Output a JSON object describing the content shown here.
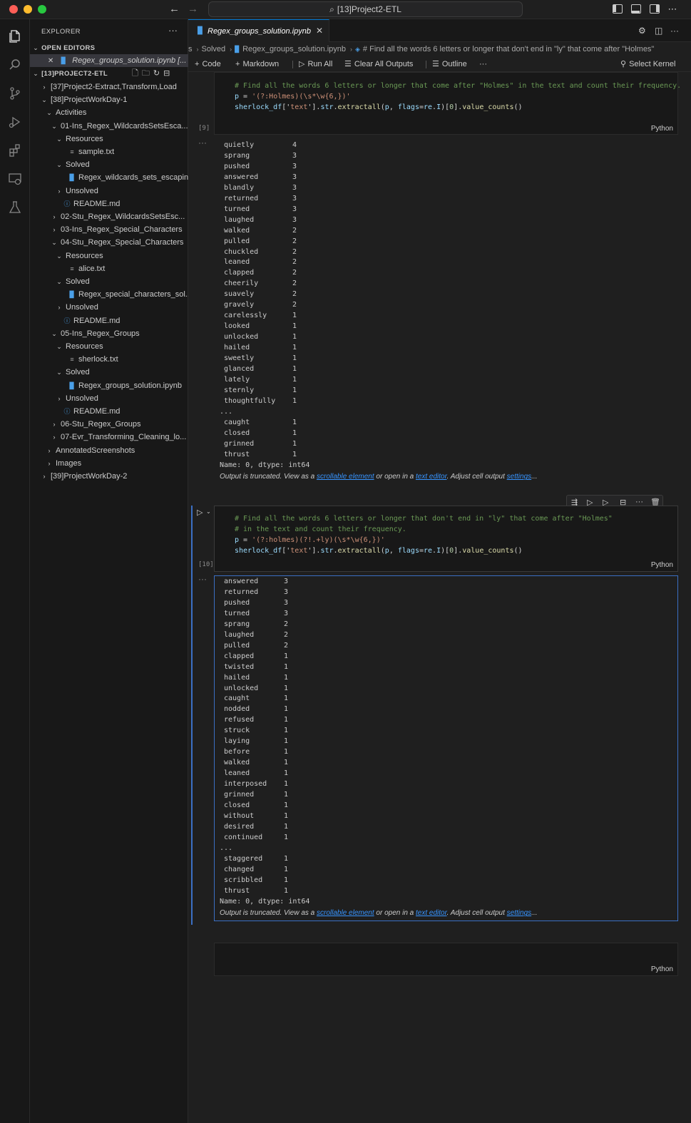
{
  "titlebar": {
    "title": "[13]Project2-ETL",
    "back_arrow": "←",
    "forward_arrow": "→",
    "search_glyph": "⌕",
    "more": "⋯"
  },
  "activitybar": {
    "items": [
      "explorer-icon",
      "search-icon",
      "source-control-icon",
      "run-debug-icon",
      "extensions-icon",
      "remote-explorer-icon",
      "testing-icon"
    ]
  },
  "sidebar": {
    "title": "EXPLORER",
    "more": "···",
    "open_editors_label": "OPEN EDITORS",
    "open_editor_file": "Regex_groups_solution.ipynb [...",
    "workspace_label": "[13]PROJECT2-ETL",
    "tree": [
      {
        "label": "[37]Project2-Extract,Transform,Load",
        "depth": 1,
        "chev": "›",
        "icon": ""
      },
      {
        "label": "[38]ProjectWorkDay-1",
        "depth": 1,
        "chev": "⌄",
        "icon": ""
      },
      {
        "label": "Activities",
        "depth": 2,
        "chev": "⌄",
        "icon": ""
      },
      {
        "label": "01-Ins_Regex_WildcardsSetsEsca...",
        "depth": 3,
        "chev": "⌄",
        "icon": ""
      },
      {
        "label": "Resources",
        "depth": 4,
        "chev": "⌄",
        "icon": ""
      },
      {
        "label": "sample.txt",
        "depth": 5,
        "chev": "",
        "icon": "txt"
      },
      {
        "label": "Solved",
        "depth": 4,
        "chev": "⌄",
        "icon": ""
      },
      {
        "label": "Regex_wildcards_sets_escapin...",
        "depth": 5,
        "chev": "",
        "icon": "nb"
      },
      {
        "label": "Unsolved",
        "depth": 4,
        "chev": "›",
        "icon": ""
      },
      {
        "label": "README.md",
        "depth": 4,
        "chev": "",
        "icon": "info"
      },
      {
        "label": "02-Stu_Regex_WildcardsSetsEsc...",
        "depth": 3,
        "chev": "›",
        "icon": ""
      },
      {
        "label": "03-Ins_Regex_Special_Characters",
        "depth": 3,
        "chev": "›",
        "icon": ""
      },
      {
        "label": "04-Stu_Regex_Special_Characters",
        "depth": 3,
        "chev": "⌄",
        "icon": ""
      },
      {
        "label": "Resources",
        "depth": 4,
        "chev": "⌄",
        "icon": ""
      },
      {
        "label": "alice.txt",
        "depth": 5,
        "chev": "",
        "icon": "txt"
      },
      {
        "label": "Solved",
        "depth": 4,
        "chev": "⌄",
        "icon": ""
      },
      {
        "label": "Regex_special_characters_sol...",
        "depth": 5,
        "chev": "",
        "icon": "nb"
      },
      {
        "label": "Unsolved",
        "depth": 4,
        "chev": "›",
        "icon": ""
      },
      {
        "label": "README.md",
        "depth": 4,
        "chev": "",
        "icon": "info"
      },
      {
        "label": "05-Ins_Regex_Groups",
        "depth": 3,
        "chev": "⌄",
        "icon": ""
      },
      {
        "label": "Resources",
        "depth": 4,
        "chev": "⌄",
        "icon": ""
      },
      {
        "label": "sherlock.txt",
        "depth": 5,
        "chev": "",
        "icon": "txt"
      },
      {
        "label": "Solved",
        "depth": 4,
        "chev": "⌄",
        "icon": ""
      },
      {
        "label": "Regex_groups_solution.ipynb",
        "depth": 5,
        "chev": "",
        "icon": "nb"
      },
      {
        "label": "Unsolved",
        "depth": 4,
        "chev": "›",
        "icon": ""
      },
      {
        "label": "README.md",
        "depth": 4,
        "chev": "",
        "icon": "info"
      },
      {
        "label": "06-Stu_Regex_Groups",
        "depth": 3,
        "chev": "›",
        "icon": ""
      },
      {
        "label": "07-Evr_Transforming_Cleaning_lo...",
        "depth": 3,
        "chev": "›",
        "icon": ""
      },
      {
        "label": "AnnotatedScreenshots",
        "depth": 2,
        "chev": "›",
        "icon": ""
      },
      {
        "label": "Images",
        "depth": 2,
        "chev": "›",
        "icon": ""
      },
      {
        "label": "[39]ProjectWorkDay-2",
        "depth": 1,
        "chev": "›",
        "icon": ""
      }
    ]
  },
  "editor": {
    "tab_label": "Regex_groups_solution.ipynb",
    "breadcrumb": {
      "parts": [
        "s",
        "Solved",
        "Regex_groups_solution.ipynb",
        "# Find all the words 6 letters or longer that don't end in \"ly\" that come after \"Holmes\""
      ]
    },
    "toolbar": {
      "code": "Code",
      "markdown": "Markdown",
      "run_all": "Run All",
      "clear_outputs": "Clear All Outputs",
      "outline": "Outline",
      "more": "···",
      "select_kernel": "Select Kernel"
    },
    "cells": [
      {
        "exec_count": "[9]",
        "language": "Python",
        "code": [
          "# Find all the words 6 letters or longer that come after \"Holmes\" in the text and count their frequency.",
          "p = '(?:Holmes)(\\s*\\w{6,})'",
          "sherlock_df['text'].str.extractall(p, flags=re.I)[0].value_counts()"
        ],
        "output_rows": [
          [
            "quietly",
            "4"
          ],
          [
            "sprang",
            "3"
          ],
          [
            "pushed",
            "3"
          ],
          [
            "answered",
            "3"
          ],
          [
            "blandly",
            "3"
          ],
          [
            "returned",
            "3"
          ],
          [
            "turned",
            "3"
          ],
          [
            "laughed",
            "3"
          ],
          [
            "walked",
            "2"
          ],
          [
            "pulled",
            "2"
          ],
          [
            "chuckled",
            "2"
          ],
          [
            "leaned",
            "2"
          ],
          [
            "clapped",
            "2"
          ],
          [
            "cheerily",
            "2"
          ],
          [
            "suavely",
            "2"
          ],
          [
            "gravely",
            "2"
          ],
          [
            "carelessly",
            "1"
          ],
          [
            "looked",
            "1"
          ],
          [
            "unlocked",
            "1"
          ],
          [
            "hailed",
            "1"
          ],
          [
            "sweetly",
            "1"
          ],
          [
            "glanced",
            "1"
          ],
          [
            "lately",
            "1"
          ],
          [
            "sternly",
            "1"
          ],
          [
            "thoughtfully",
            "1"
          ]
        ],
        "ellipsis": "...",
        "output_tail": [
          [
            "caught",
            "1"
          ],
          [
            "closed",
            "1"
          ],
          [
            "grinned",
            "1"
          ],
          [
            "thrust",
            "1"
          ]
        ],
        "dtype_line": "Name: 0, dtype: int64"
      },
      {
        "exec_count": "[10]",
        "language": "Python",
        "code": [
          "# Find all the words 6 letters or longer that don't end in \"ly\" that come after \"Holmes\"",
          "# in the text and count their frequency.",
          "p = '(?:holmes)(?!.+ly)(\\s*\\w{6,})'",
          "sherlock_df['text'].str.extractall(p, flags=re.I)[0].value_counts()"
        ],
        "output_rows": [
          [
            "answered",
            "3"
          ],
          [
            "returned",
            "3"
          ],
          [
            "pushed",
            "3"
          ],
          [
            "turned",
            "3"
          ],
          [
            "sprang",
            "2"
          ],
          [
            "laughed",
            "2"
          ],
          [
            "pulled",
            "2"
          ],
          [
            "clapped",
            "1"
          ],
          [
            "twisted",
            "1"
          ],
          [
            "hailed",
            "1"
          ],
          [
            "unlocked",
            "1"
          ],
          [
            "caught",
            "1"
          ],
          [
            "nodded",
            "1"
          ],
          [
            "refused",
            "1"
          ],
          [
            "struck",
            "1"
          ],
          [
            "laying",
            "1"
          ],
          [
            "before",
            "1"
          ],
          [
            "walked",
            "1"
          ],
          [
            "leaned",
            "1"
          ],
          [
            "interposed",
            "1"
          ],
          [
            "grinned",
            "1"
          ],
          [
            "closed",
            "1"
          ],
          [
            "without",
            "1"
          ],
          [
            "desired",
            "1"
          ],
          [
            "continued",
            "1"
          ]
        ],
        "ellipsis": "...",
        "output_tail": [
          [
            "staggered",
            "1"
          ],
          [
            "changed",
            "1"
          ],
          [
            "scribbled",
            "1"
          ],
          [
            "thrust",
            "1"
          ]
        ],
        "dtype_line": "Name: 0, dtype: int64"
      },
      {
        "exec_count": "",
        "language": "Python",
        "code": []
      }
    ],
    "truncated_note": {
      "prefix": "Output is truncated. View as a ",
      "link1": "scrollable element",
      "mid1": " or open in a ",
      "link2": "text editor",
      "mid2": ". Adjust cell output ",
      "link3": "settings",
      "suffix": "..."
    },
    "output_dots": "···"
  },
  "colors": {
    "accent": "#0078d4",
    "focus_border": "#3b6fc4",
    "link": "#3794ff",
    "comment": "#6a9955",
    "string": "#ce9178",
    "variable": "#9cdcfe",
    "function": "#dcdcaa"
  }
}
